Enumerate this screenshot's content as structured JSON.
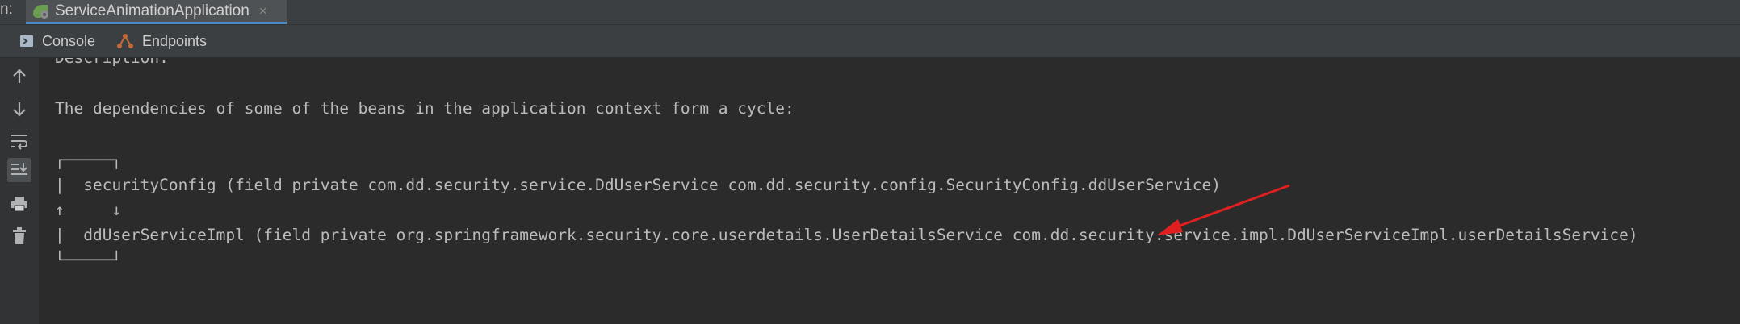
{
  "run_tabs": {
    "prefix": "n:",
    "active_tab": "ServiceAnimationApplication",
    "close_glyph": "×",
    "icon": "spring-boot-app-icon"
  },
  "sub_tabs": [
    {
      "label": "Console",
      "icon": "console-icon"
    },
    {
      "label": "Endpoints",
      "icon": "endpoints-icon"
    }
  ],
  "toolbar": [
    {
      "name": "scroll-up-icon"
    },
    {
      "name": "scroll-down-icon"
    },
    {
      "name": "soft-wrap-icon"
    },
    {
      "name": "scroll-to-end-icon",
      "active": true
    },
    {
      "name": "print-icon"
    },
    {
      "name": "clear-all-icon"
    }
  ],
  "console": {
    "lines": [
      "Description:",
      "The dependencies of some of the beans in the application context form a cycle:",
      "┌─────┐",
      "|  securityConfig (field private com.dd.security.service.DdUserService com.dd.security.config.SecurityConfig.ddUserService)",
      "↑     ↓",
      "|  ddUserServiceImpl (field private org.springframework.security.core.userdetails.UserDetailsService com.dd.security.service.impl.DdUserServiceImpl.userDetailsService)",
      "└─────┘"
    ]
  },
  "annotation": {
    "color": "#e02020",
    "points_to": "ddUserService"
  },
  "colors": {
    "background": "#2b2b2b",
    "panel": "#3c3f41",
    "text": "#bbbbbb",
    "tab_underline": "#4a88c7"
  }
}
